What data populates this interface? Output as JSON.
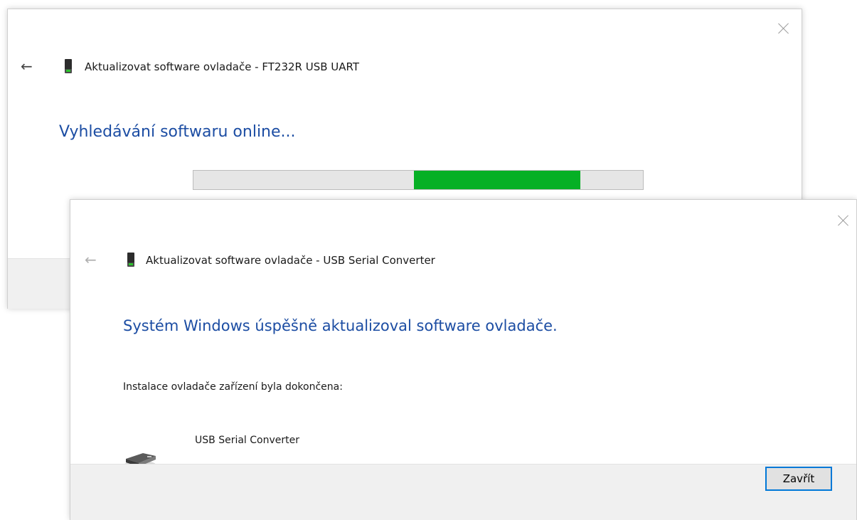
{
  "dialog_back": {
    "title": "Aktualizovat software ovladače - FT232R USB UART",
    "heading": "Vyhledávání softwaru online...",
    "progress": {
      "fill_fraction": 0.37,
      "fill_start_fraction": 0.49,
      "fill_color": "#06b025",
      "track_color": "#e6e6e6"
    }
  },
  "dialog_front": {
    "title": "Aktualizovat software ovladače - USB Serial Converter",
    "heading": "Systém Windows úspěšně aktualizoval software ovladače.",
    "message": "Instalace ovladače zařízení byla dokončena:",
    "device_name": "USB Serial Converter",
    "close_button_label": "Zavřít"
  },
  "colors": {
    "heading": "#1c4da3",
    "accent_border": "#0078d7"
  },
  "icons": {
    "back": "arrow-left-icon",
    "close": "close-icon",
    "device_small": "usb-device-icon",
    "device_large": "usb-serial-converter-icon"
  }
}
